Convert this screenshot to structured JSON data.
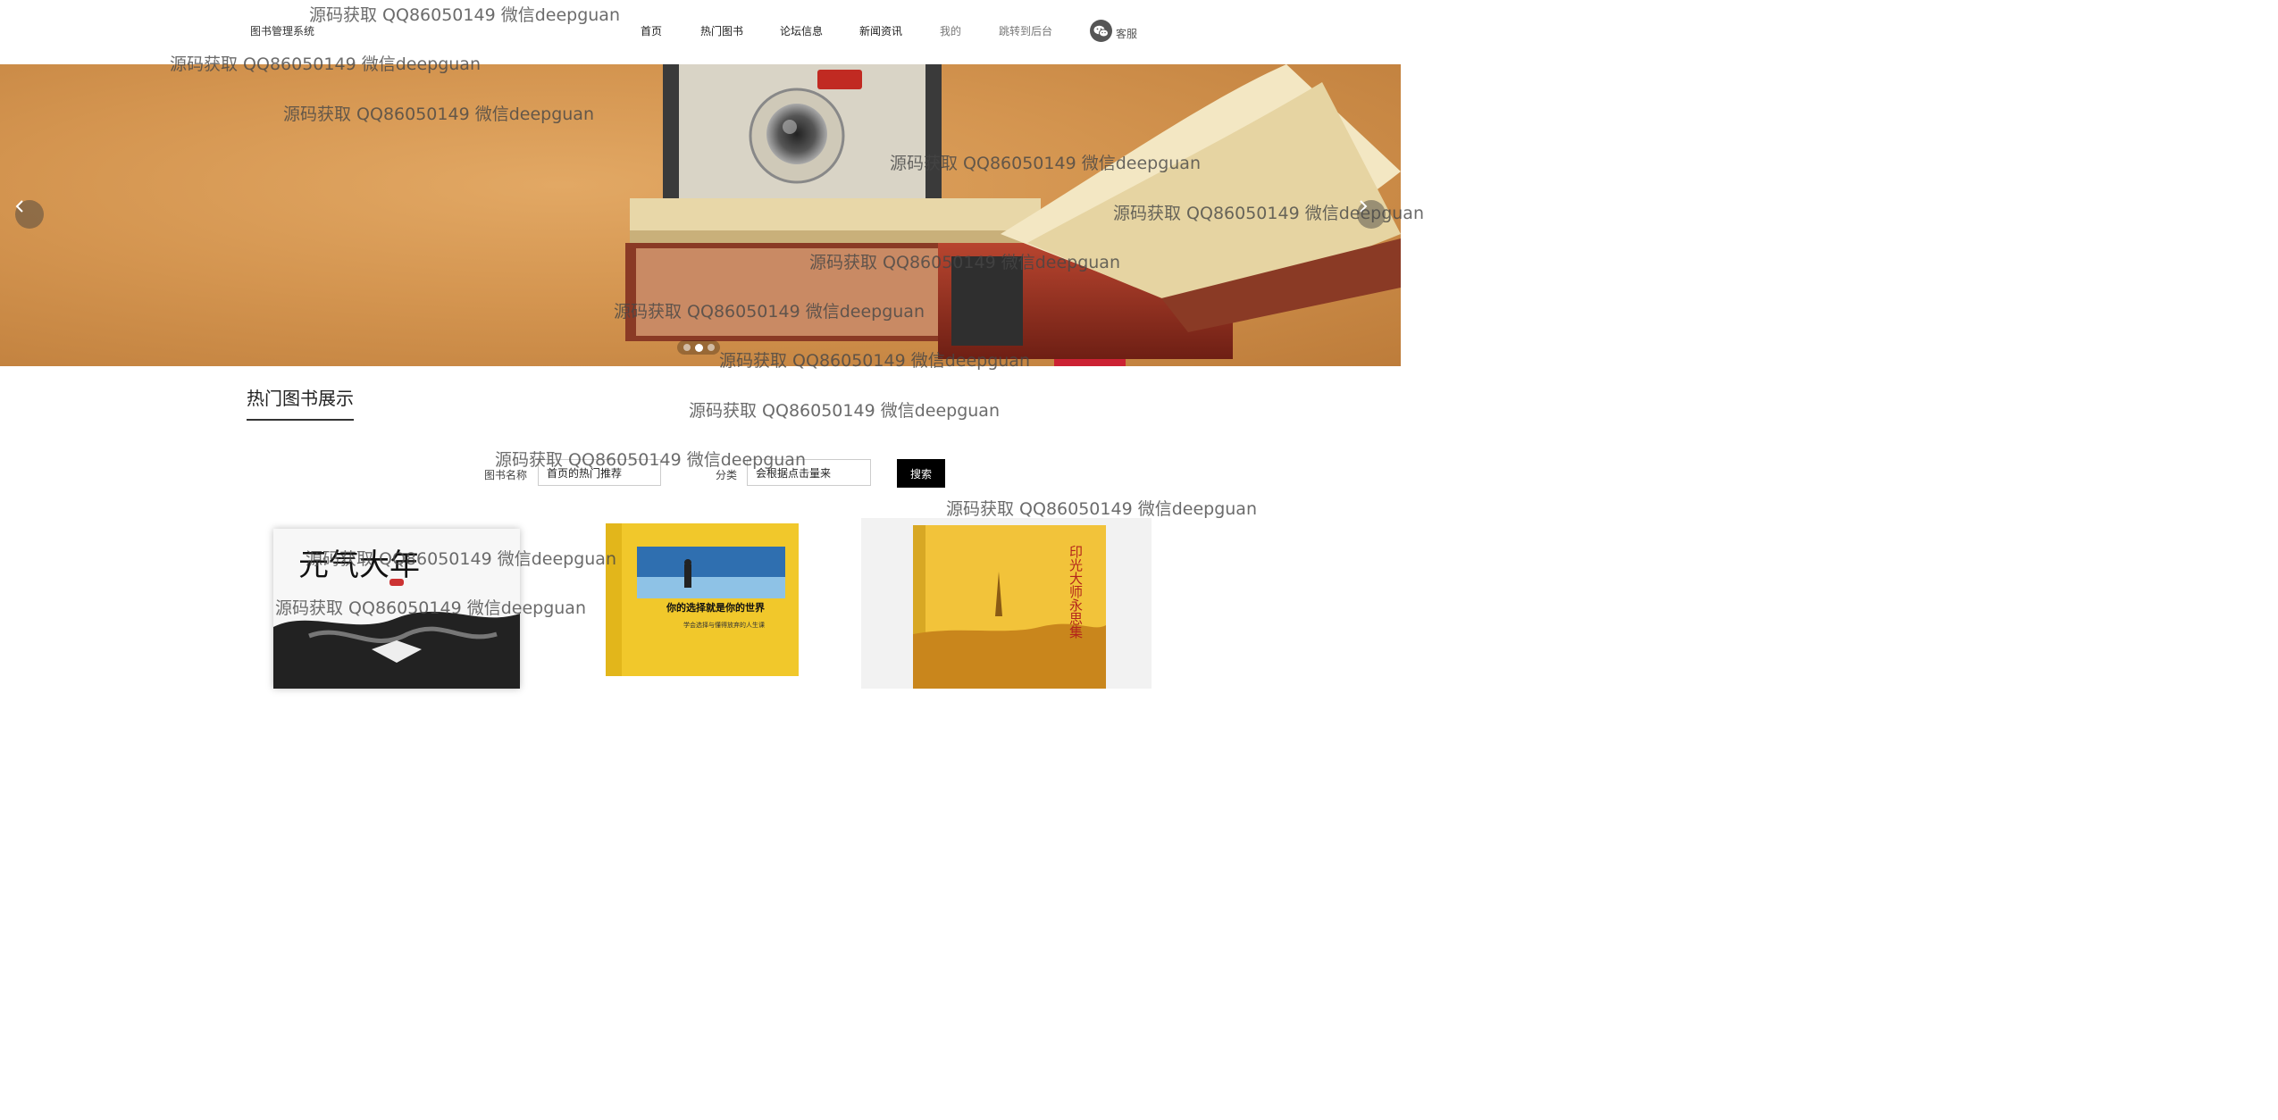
{
  "header": {
    "brand": "图书管理系统",
    "nav": [
      "首页",
      "热门图书",
      "论坛信息",
      "新闻资讯",
      "我的",
      "跳转到后台"
    ],
    "service_label": "客服"
  },
  "banner": {
    "slide_count": 3,
    "active_slide": 2
  },
  "section": {
    "title": "热门图书展示"
  },
  "search": {
    "name_label": "图书名称",
    "name_value": "首页的热门推荐",
    "category_label": "分类",
    "category_value": "会根据点击量来",
    "button_label": "搜索"
  },
  "books": [
    {
      "title": "元气大年",
      "cover": "black-white-ink"
    },
    {
      "title": "你的选择就是你的世界",
      "subtitle": "学会选择与懂得放弃的人生课",
      "cover": "yellow-blue"
    },
    {
      "title": "印光大师永思集",
      "cover": "yellow-gold"
    }
  ],
  "watermark": "源码获取 QQ86050149 微信deepguan",
  "colors": {
    "accent": "#000000",
    "banner": "#d49550"
  }
}
